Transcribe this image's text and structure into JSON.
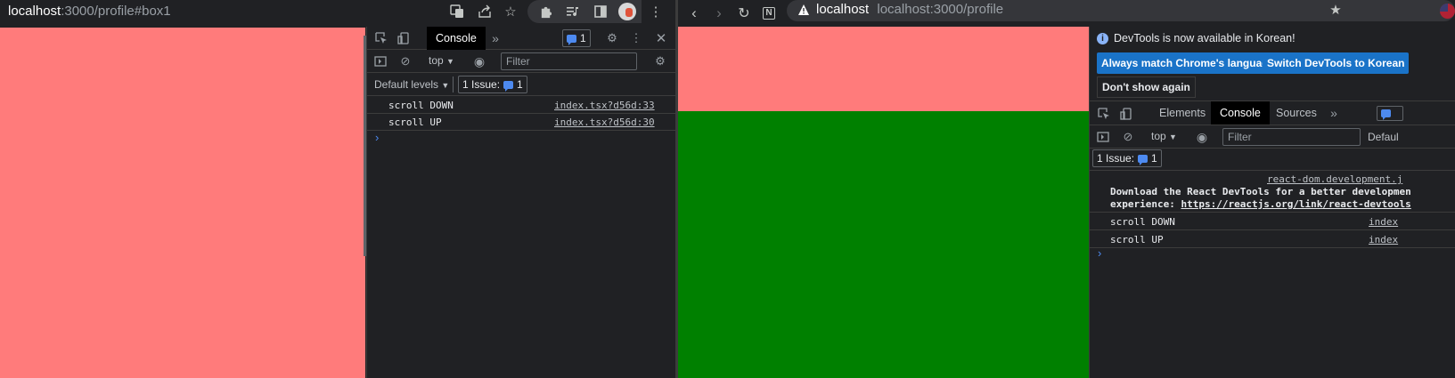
{
  "left_window": {
    "address": {
      "host": "localhost",
      "rest": ":3000/profile#box1"
    },
    "page_color": "#ff7b7b",
    "devtools": {
      "tabs": {
        "console": "Console"
      },
      "issue_badge_count": "1",
      "context": "top",
      "filter_placeholder": "Filter",
      "levels": "Default levels",
      "issues": {
        "label": "1 Issue:",
        "count": "1"
      },
      "logs": [
        {
          "message": "scroll DOWN",
          "source": "index.tsx?d56d:33"
        },
        {
          "message": "scroll UP",
          "source": "index.tsx?d56d:30"
        }
      ],
      "prompt": "›"
    }
  },
  "right_window": {
    "address": {
      "host": "localhost",
      "rest": "localhost:3000/profile"
    },
    "page": {
      "top_color": "#ff7b7b",
      "bottom_color": "#008000"
    },
    "devtools": {
      "info_banner": "DevTools is now available in Korean!",
      "buttons": {
        "match_language": "Always match Chrome's language",
        "switch_korean": "Switch DevTools to Korean",
        "dont_show": "Don't show again"
      },
      "tabs": {
        "elements": "Elements",
        "console": "Console",
        "sources": "Sources"
      },
      "context": "top",
      "filter_placeholder": "Filter",
      "levels": "Defaul",
      "issues": {
        "label": "1 Issue:",
        "count": "1"
      },
      "react_source": "react-dom.development.j",
      "react_message_line1": "Download the React DevTools for a better developmen",
      "react_message_line2_prefix": "experience: ",
      "react_message_link": "https://reactjs.org/link/react-devtools",
      "logs": [
        {
          "message": "scroll DOWN",
          "source": "index"
        },
        {
          "message": "scroll UP",
          "source": "index"
        }
      ],
      "prompt": "›"
    }
  },
  "colors": {
    "accent": "#4d8af0",
    "button_blue": "#1a73c8",
    "devtools_bg": "#202124"
  }
}
